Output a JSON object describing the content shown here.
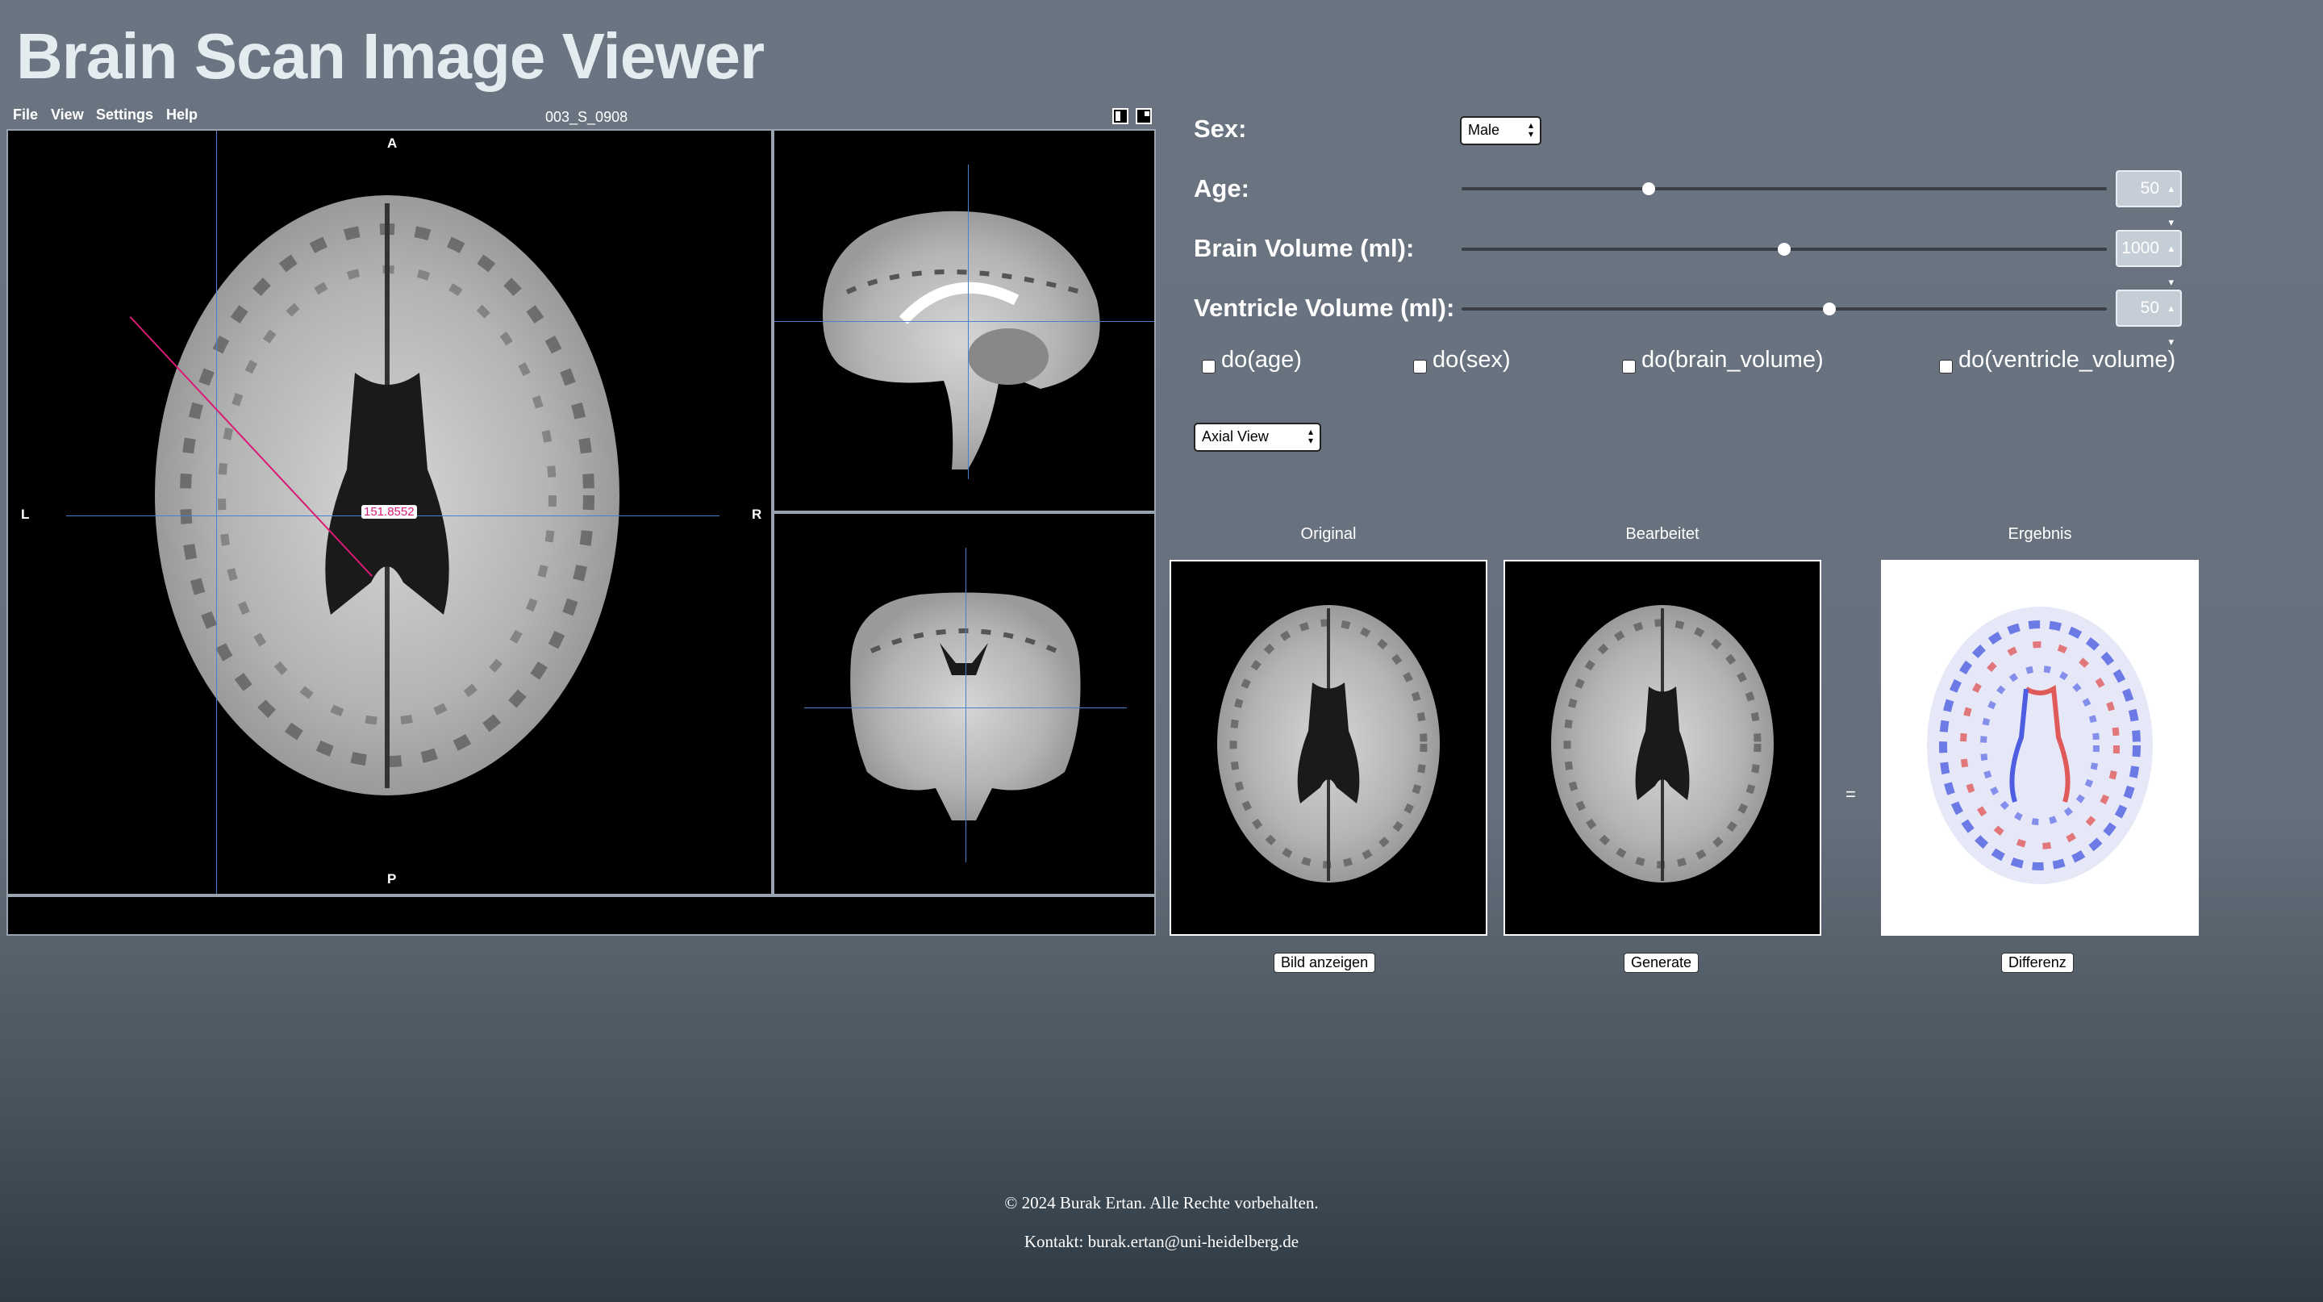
{
  "page_title": "Brain Scan Image Viewer",
  "viewer": {
    "menu": [
      "File",
      "View",
      "Settings",
      "Help"
    ],
    "filename": "003_S_0908",
    "orientation": {
      "top": "A",
      "bottom": "P",
      "left": "L",
      "right": "R"
    },
    "measurement": "151.8552"
  },
  "controls": {
    "sex": {
      "label": "Sex:",
      "value": "Male"
    },
    "age": {
      "label": "Age:",
      "value": "50",
      "fraction": 0.29
    },
    "brain_volume": {
      "label": "Brain Volume (ml):",
      "value": "1000",
      "fraction": 0.5
    },
    "ventricle_volume": {
      "label": "Ventricle Volume (ml):",
      "value": "50",
      "fraction": 0.57
    },
    "interventions": [
      "do(age)",
      "do(sex)",
      "do(brain_volume)",
      "do(ventricle_volume)"
    ],
    "view_select": "Axial View"
  },
  "results": {
    "original": {
      "caption": "Original",
      "button": "Bild anzeigen"
    },
    "edited": {
      "caption": "Bearbeitet",
      "button": "Generate"
    },
    "equals": "=",
    "result": {
      "caption": "Ergebnis",
      "button": "Differenz"
    }
  },
  "footer": {
    "copyright": "© 2024 Burak Ertan. Alle Rechte vorbehalten.",
    "contact": "Kontakt: burak.ertan@uni-heidelberg.de"
  }
}
